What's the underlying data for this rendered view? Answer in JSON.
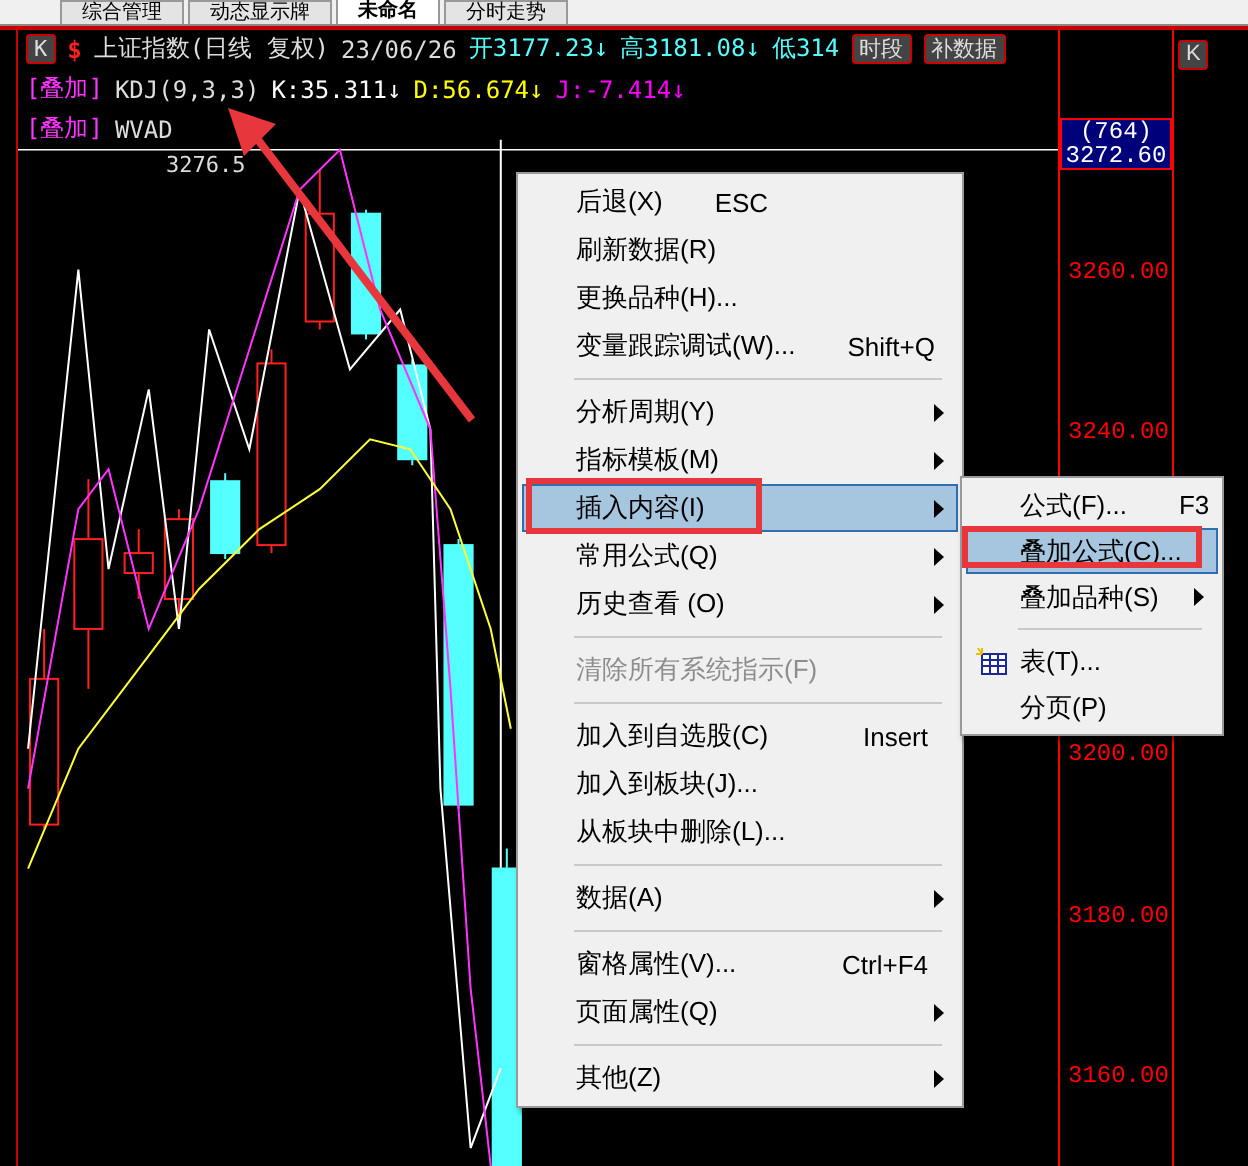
{
  "tabs": [
    {
      "label": "综合管理",
      "selected": false
    },
    {
      "label": "动态显示牌",
      "selected": false
    },
    {
      "label": "未命名",
      "selected": true
    },
    {
      "label": "分时走势",
      "selected": false
    }
  ],
  "header": {
    "period_button": "K",
    "symbol_mark": "$",
    "title": "上证指数(日线 复权)",
    "date": "23/06/26",
    "open": "开3177.23↓",
    "high": "高3181.08↓",
    "low": "低314",
    "buttons": [
      "时段",
      "补数据"
    ]
  },
  "overlays": [
    {
      "tag": "[叠加]",
      "name": "KDJ(9,3,3)",
      "values": [
        {
          "text": "K:35.311↓",
          "color": "#ffffff"
        },
        {
          "text": "D:56.674↓",
          "color": "#ffff00"
        },
        {
          "text": "J:-7.414↓",
          "color": "#ff00ff"
        }
      ]
    },
    {
      "tag": "[叠加]",
      "name": "WVAD"
    }
  ],
  "chart": {
    "peak_label": "3276.5"
  },
  "axis": {
    "price_box": {
      "count": "(764)",
      "price": "3272.60"
    },
    "ticks": [
      "3260.00",
      "3240.00",
      "3200.00",
      "3180.00",
      "3160.00"
    ]
  },
  "side_panel": {
    "period_button": "K"
  },
  "menu": {
    "items": [
      {
        "kind": "item",
        "label": "后退(X)",
        "shortcut": "ESC",
        "submenu": false,
        "disabled": false,
        "selected": false,
        "annotated": false
      },
      {
        "kind": "item",
        "label": "刷新数据(R)",
        "submenu": false,
        "disabled": false,
        "selected": false,
        "annotated": false
      },
      {
        "kind": "item",
        "label": "更换品种(H)...",
        "submenu": false,
        "disabled": false,
        "selected": false,
        "annotated": false
      },
      {
        "kind": "item",
        "label": "变量跟踪调试(W)...",
        "shortcut": "Shift+Q",
        "submenu": false,
        "disabled": false,
        "selected": false,
        "annotated": false
      },
      {
        "kind": "separator"
      },
      {
        "kind": "item",
        "label": "分析周期(Y)",
        "submenu": true,
        "disabled": false,
        "selected": false,
        "annotated": false
      },
      {
        "kind": "item",
        "label": "指标模板(M)",
        "submenu": true,
        "disabled": false,
        "selected": false,
        "annotated": false
      },
      {
        "kind": "item",
        "label": "插入内容(I)",
        "submenu": true,
        "disabled": false,
        "selected": true,
        "annotated": true
      },
      {
        "kind": "item",
        "label": "常用公式(Q)",
        "submenu": true,
        "disabled": false,
        "selected": false,
        "annotated": false
      },
      {
        "kind": "item",
        "label": "历史查看 (O)",
        "submenu": true,
        "disabled": false,
        "selected": false,
        "annotated": false
      },
      {
        "kind": "separator"
      },
      {
        "kind": "item",
        "label": "清除所有系统指示(F)",
        "submenu": false,
        "disabled": true,
        "selected": false,
        "annotated": false
      },
      {
        "kind": "separator"
      },
      {
        "kind": "item",
        "label": "加入到自选股(C)",
        "shortcut": "Insert",
        "submenu": false,
        "disabled": false,
        "selected": false,
        "annotated": false
      },
      {
        "kind": "item",
        "label": "加入到板块(J)...",
        "submenu": false,
        "disabled": false,
        "selected": false,
        "annotated": false
      },
      {
        "kind": "item",
        "label": "从板块中删除(L)...",
        "submenu": false,
        "disabled": false,
        "selected": false,
        "annotated": false
      },
      {
        "kind": "separator"
      },
      {
        "kind": "item",
        "label": "数据(A)",
        "submenu": true,
        "disabled": false,
        "selected": false,
        "annotated": false
      },
      {
        "kind": "separator"
      },
      {
        "kind": "item",
        "label": "窗格属性(V)...",
        "shortcut": "Ctrl+F4",
        "submenu": false,
        "disabled": false,
        "selected": false,
        "annotated": false
      },
      {
        "kind": "item",
        "label": "页面属性(Q)",
        "submenu": true,
        "disabled": false,
        "selected": false,
        "annotated": false
      },
      {
        "kind": "separator"
      },
      {
        "kind": "item",
        "label": "其他(Z)",
        "submenu": true,
        "disabled": false,
        "selected": false,
        "annotated": false
      }
    ]
  },
  "submenu": {
    "items": [
      {
        "kind": "item",
        "label": "公式(F)...",
        "shortcut": "F3",
        "submenu": false,
        "icon": false,
        "selected": false,
        "annotated": false
      },
      {
        "kind": "item",
        "label": "叠加公式(C)...",
        "submenu": false,
        "icon": false,
        "selected": true,
        "annotated": true
      },
      {
        "kind": "item",
        "label": "叠加品种(S)",
        "submenu": true,
        "icon": false,
        "selected": false,
        "annotated": false
      },
      {
        "kind": "separator"
      },
      {
        "kind": "item",
        "label": "表(T)...",
        "submenu": false,
        "icon": true,
        "selected": false,
        "annotated": false
      },
      {
        "kind": "item",
        "label": "分页(P)",
        "submenu": false,
        "icon": false,
        "selected": false,
        "annotated": false
      }
    ]
  }
}
